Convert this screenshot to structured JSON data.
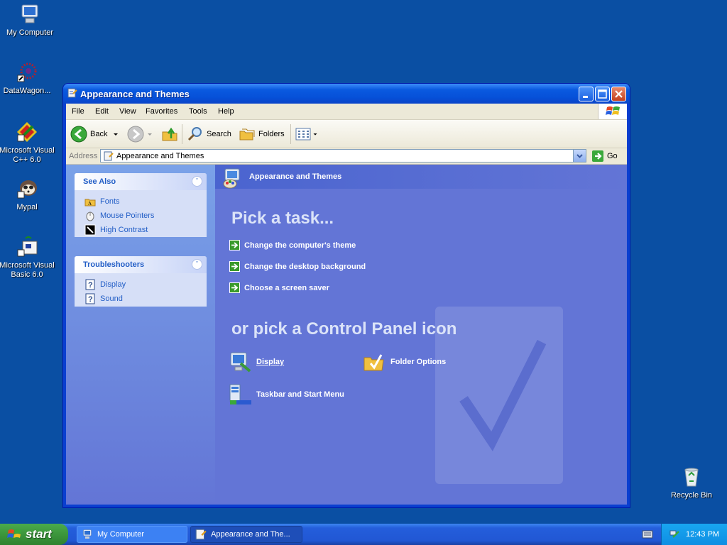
{
  "desktop": {
    "icons": [
      {
        "label": "My Computer",
        "icon": "my-computer-icon"
      },
      {
        "label": "DataWagon...",
        "icon": "datawagon-icon"
      },
      {
        "label": "Microsoft Visual C++ 6.0",
        "icon": "visual-cpp-icon"
      },
      {
        "label": "Mypal",
        "icon": "mypal-icon"
      },
      {
        "label": "Microsoft Visual Basic 6.0",
        "icon": "visual-basic-icon"
      },
      {
        "label": "Recycle Bin",
        "icon": "recycle-bin-icon"
      }
    ]
  },
  "window": {
    "title": "Appearance and Themes",
    "menu": [
      "File",
      "Edit",
      "View",
      "Favorites",
      "Tools",
      "Help"
    ],
    "toolbar": {
      "back": "Back",
      "search": "Search",
      "folders": "Folders"
    },
    "address": {
      "label": "Address",
      "value": "Appearance and Themes",
      "go": "Go"
    }
  },
  "left_pane": {
    "see_also": {
      "title": "See Also",
      "items": [
        "Fonts",
        "Mouse Pointers",
        "High Contrast"
      ]
    },
    "troubleshooters": {
      "title": "Troubleshooters",
      "items": [
        "Display",
        "Sound"
      ]
    }
  },
  "main": {
    "header": "Appearance and Themes",
    "pick_task_title": "Pick a task...",
    "tasks": [
      "Change the computer's theme",
      "Change the desktop background",
      "Choose a screen saver"
    ],
    "pick_icon_title": "or pick a Control Panel icon",
    "cp_icons": [
      "Display",
      "Folder Options",
      "Taskbar and Start Menu"
    ]
  },
  "taskbar": {
    "start_label": "start",
    "buttons": [
      "My Computer",
      "Appearance and The..."
    ],
    "clock": "12:43 PM"
  },
  "colors": {
    "desktop": "#0a4fa3",
    "pane": "#6375d6",
    "link": "#215dc6"
  }
}
